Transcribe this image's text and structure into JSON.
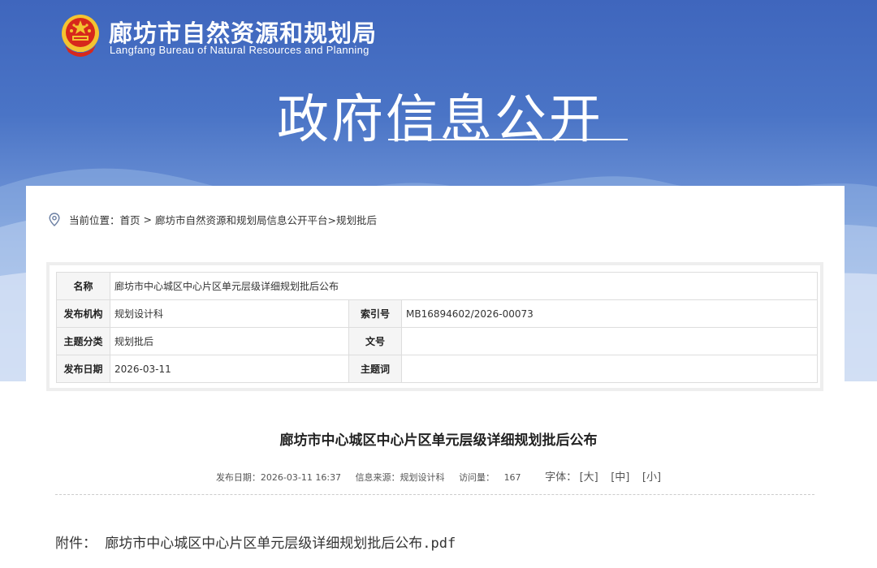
{
  "header": {
    "title_cn": "廊坊市自然资源和规划局",
    "title_en": "Langfang Bureau of Natural Resources and Planning",
    "hero_title": "政府信息公开"
  },
  "breadcrumb": {
    "prefix": "当前位置：",
    "home": "首页",
    "separator": ">",
    "platform": "廊坊市自然资源和规划局信息公开平台",
    "current": ">规划批后"
  },
  "meta_table": {
    "name_label": "名称",
    "name_value": "廊坊市中心城区中心片区单元层级详细规划批后公布",
    "publisher_label": "发布机构",
    "publisher_value": "规划设计科",
    "index_label": "索引号",
    "index_value": "MB16894602/2026-00073",
    "topic_label": "主题分类",
    "topic_value": "规划批后",
    "docno_label": "文号",
    "docno_value": "",
    "date_label": "发布日期",
    "date_value": "2026-03-11",
    "keywords_label": "主题词",
    "keywords_value": ""
  },
  "article": {
    "title": "廊坊市中心城区中心片区单元层级详细规划批后公布",
    "publish_date": "发布日期：2026-03-11 16:37",
    "source": "信息来源：规划设计科",
    "visits_label": "访问量：",
    "visits_value": "167",
    "font_size_label": "字体：",
    "font_large": "[大]",
    "font_medium": "[中]",
    "font_small": "[小]",
    "attachment_label": "附件：",
    "attachment_name": "廊坊市中心城区中心片区单元层级详细规划批后公布.pdf"
  },
  "colors": {
    "banner_blue": "#3f66bd",
    "emblem_red": "#d7281c",
    "emblem_gold": "#f4c430"
  },
  "icons": [
    "national-emblem-icon",
    "location-pin-icon"
  ]
}
